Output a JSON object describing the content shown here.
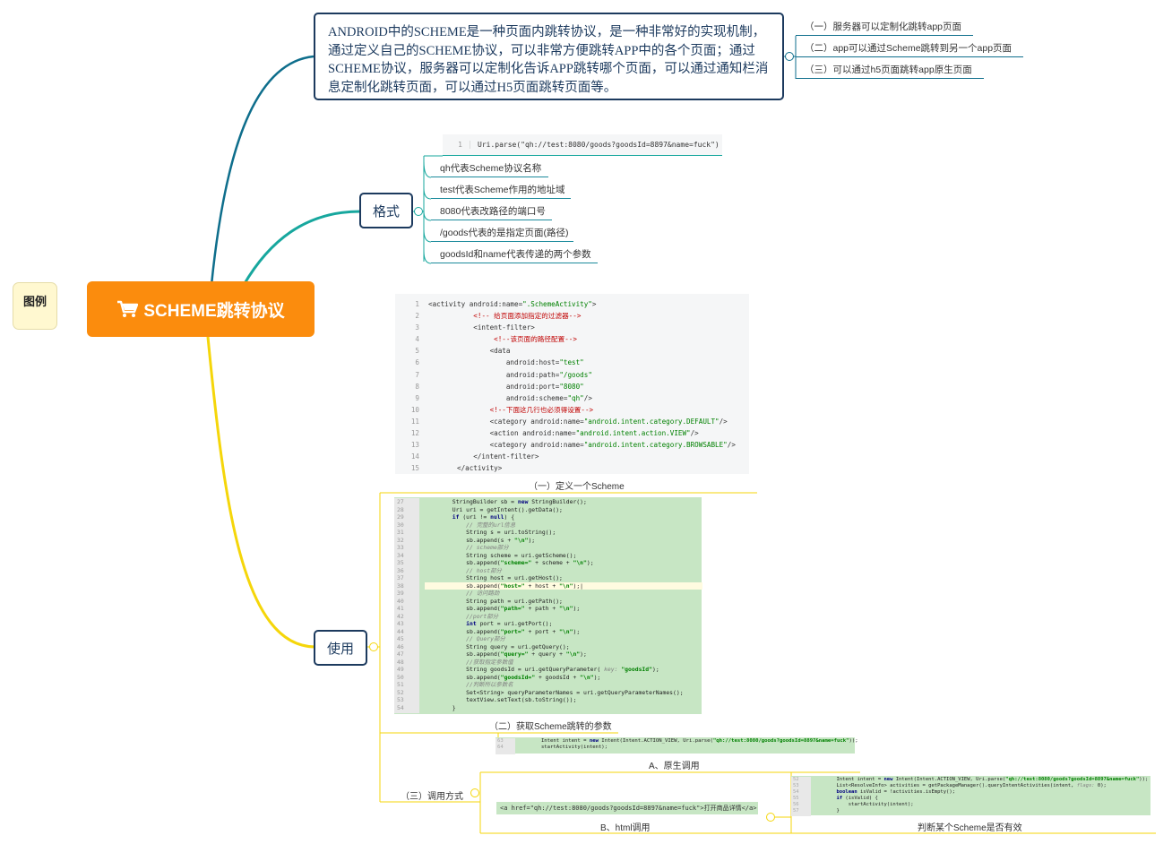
{
  "legend": {
    "label": "图例"
  },
  "root": {
    "label": "SCHEME跳转协议",
    "icon": "cart-icon"
  },
  "description": {
    "text": "ANDROID中的SCHEME是一种页面内跳转协议，是一种非常好的实现机制，通过定义自己的SCHEME协议，可以非常方便跳转APP中的各个页面；通过SCHEME协议，服务器可以定制化告诉APP跳转哪个页面，可以通过通知栏消息定制化跳转页面，可以通过H5页面跳转页面等。",
    "items": [
      "（一）服务器可以定制化跳转app页面",
      "（二）app可以通过Scheme跳转到另一个app页面",
      "（三）可以通过h5页面跳转app原生页面"
    ]
  },
  "format": {
    "label": "格式",
    "code_line_no": "1",
    "code": "Uri.parse(\"qh://test:8080/goods?goodsId=8897&name=fuck\")",
    "items": [
      "qh代表Scheme协议名称",
      "test代表Scheme作用的地址域",
      "8080代表改路径的端口号",
      "/goods代表的是指定页面(路径)",
      "goodsId和name代表传递的两个参数"
    ]
  },
  "define": {
    "caption": "（一）定义一个Scheme",
    "line_numbers": [
      "1",
      "2",
      "3",
      "4",
      "5",
      "6",
      "7",
      "8",
      "9",
      "10",
      "11",
      "12",
      "13",
      "14",
      "15"
    ]
  },
  "use": {
    "label": "使用",
    "params_caption": "（二）获取Scheme跳转的参数",
    "java_line_numbers": [
      "27",
      "28",
      "29",
      "30",
      "31",
      "32",
      "33",
      "34",
      "35",
      "36",
      "37",
      "38",
      "39",
      "40",
      "41",
      "42",
      "43",
      "44",
      "45",
      "46",
      "47",
      "48",
      "49",
      "50",
      "51",
      "52",
      "53",
      "54"
    ],
    "call_methods": {
      "label": "（三）调用方式",
      "native_caption": "A、原生调用",
      "html_caption": "B、html调用",
      "valid_caption": "判断某个Scheme是否有效",
      "html_code": "<a href=\"qh://test:8080/goods?goodsId=8897&name=fuck\">打开商品详情</a>"
    }
  },
  "colors": {
    "root": "#fb8c0d",
    "branch_blue": "#0e6e8c",
    "branch_teal": "#17a79e",
    "branch_yellow": "#f5d60a",
    "node_border": "#1c3a5e",
    "code_green": "#c7e6c4"
  }
}
